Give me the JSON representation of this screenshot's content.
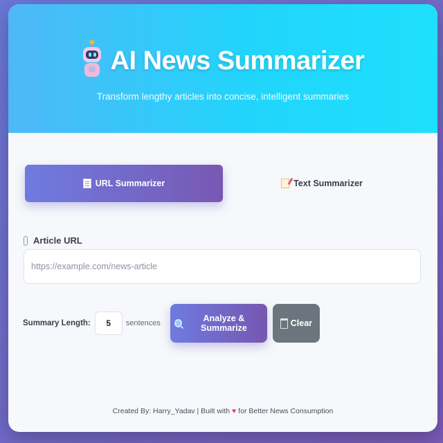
{
  "header": {
    "title": "AI News Summarizer",
    "subtitle": "Transform lengthy articles into concise, intelligent summaries",
    "logo_icon": "robot-icon"
  },
  "tabs": [
    {
      "label": "URL Summarizer",
      "icon": "document-icon",
      "active": true
    },
    {
      "label": "Text Summarizer",
      "icon": "memo-icon",
      "active": false
    }
  ],
  "url_field": {
    "label": "Article URL",
    "icon": "paperclip-icon",
    "placeholder": "https://example.com/news-article",
    "value": ""
  },
  "controls": {
    "summary_length_label": "Summary Length:",
    "summary_length_value": "5",
    "sentences_label": "sentences",
    "analyze_label": "Analyze & Summarize",
    "analyze_icon": "magnifier-icon",
    "clear_label": "Clear",
    "clear_icon": "trash-icon"
  },
  "footer": {
    "before": "Created By: Harry_Yadav | Built with ",
    "heart": "♥",
    "after": " for Better News Consumption"
  },
  "colors": {
    "header_start": "#4fb8f7",
    "header_end": "#1de0fc",
    "accent_start": "#6f7be0",
    "accent_end": "#7656b0",
    "clear_button": "#6c757d"
  }
}
